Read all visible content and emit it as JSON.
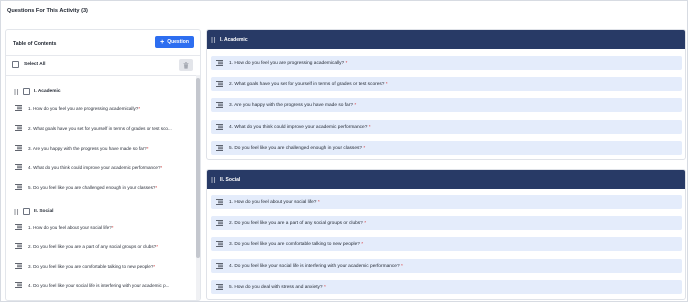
{
  "page": {
    "title": "Questions For This Activity (3)"
  },
  "toc": {
    "title": "Table of Contents",
    "add_button": "Question",
    "select_all": "Select All",
    "sections": [
      {
        "label": "I. Academic",
        "items": [
          {
            "text": "1. How do you feel you are progressing academically?",
            "required": "*"
          },
          {
            "text": "2. What goals have you set for yourself in terms of grades or test sco...",
            "required": ""
          },
          {
            "text": "3. Are you happy with the progress you have made so far?",
            "required": "*"
          },
          {
            "text": "4. What do you think could improve your academic performance?",
            "required": "*"
          },
          {
            "text": "5. Do you feel like you are challenged enough in your classes?",
            "required": "*"
          }
        ]
      },
      {
        "label": "II. Social",
        "items": [
          {
            "text": "1. How do you feel about your social life?",
            "required": "*"
          },
          {
            "text": "2. Do you feel like you are a part of any social groups or clubs?",
            "required": "*"
          },
          {
            "text": "3. Do you feel like you are comfortable talking to new people?",
            "required": "*"
          },
          {
            "text": "4. Do you feel like your social life is interfering with your academic p...",
            "required": ""
          }
        ]
      }
    ]
  },
  "main": {
    "sections": [
      {
        "label": "I. Academic",
        "questions": [
          {
            "text": "1. How do you feel you are progressing academically?",
            "required": "*"
          },
          {
            "text": "2. What goals have you set for yourself in terms of grades or test scores?",
            "required": "*"
          },
          {
            "text": "3. Are you happy with the progress you have made so far?",
            "required": "*"
          },
          {
            "text": "4. What do you think could improve your academic performance?",
            "required": "*"
          },
          {
            "text": "5. Do you feel like you are challenged enough in your classes?",
            "required": "*"
          }
        ]
      },
      {
        "label": "II. Social",
        "questions": [
          {
            "text": "1. How do you feel about your social life?",
            "required": "*"
          },
          {
            "text": "2. Do you feel like you are a part of any social groups or clubs?",
            "required": "*"
          },
          {
            "text": "3. Do you feel like you are comfortable talking to new people?",
            "required": "*"
          },
          {
            "text": "4. Do you feel like your social life is interfering with your academic performance?",
            "required": "*"
          },
          {
            "text": "5. How do you deal with stress and anxiety?",
            "required": "*"
          }
        ]
      }
    ]
  },
  "colors": {
    "accent": "#2d6ef0",
    "header": "#283a66",
    "row": "#e4ecfb",
    "required": "#d93535"
  }
}
